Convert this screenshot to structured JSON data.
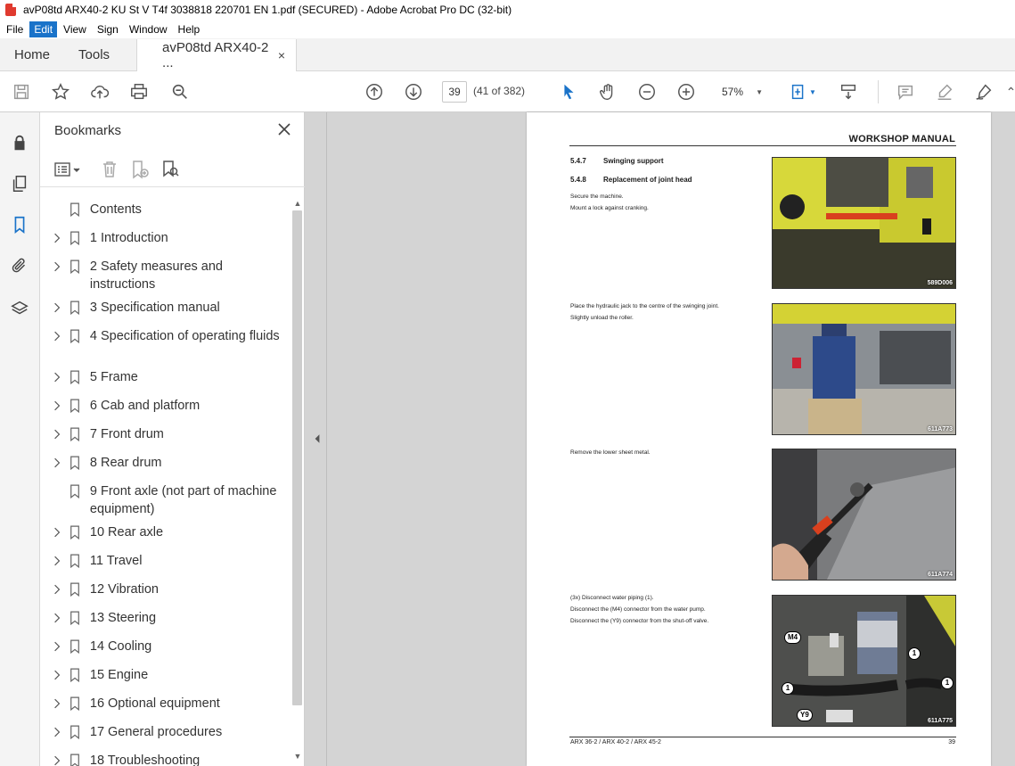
{
  "window": {
    "title": "avP08td ARX40-2 KU St V T4f 3038818 220701 EN 1.pdf (SECURED) - Adobe Acrobat Pro DC (32-bit)"
  },
  "menu": [
    "File",
    "Edit",
    "View",
    "Sign",
    "Window",
    "Help"
  ],
  "menu_active": "Edit",
  "tabs": {
    "home": "Home",
    "tools": "Tools",
    "doc": "avP08td ARX40-2 ...",
    "close": "×"
  },
  "toolbar": {
    "page_current": "39",
    "page_count": "(41 of 382)",
    "zoom": "57%"
  },
  "bookmarks": {
    "title": "Bookmarks",
    "items": [
      {
        "label": "Contents",
        "expandable": false
      },
      {
        "label": "1 Introduction",
        "expandable": true
      },
      {
        "label": "2 Safety measures and instructions",
        "expandable": true
      },
      {
        "label": "3 Specification manual",
        "expandable": true
      },
      {
        "label": "4 Specification of operating fluids",
        "expandable": true
      },
      {
        "label": "5 Frame",
        "expandable": true
      },
      {
        "label": "6 Cab and platform",
        "expandable": true
      },
      {
        "label": "7 Front drum",
        "expandable": true
      },
      {
        "label": "8 Rear drum",
        "expandable": true
      },
      {
        "label": "9 Front axle (not part of machine equipment)",
        "expandable": false
      },
      {
        "label": "10 Rear axle",
        "expandable": true
      },
      {
        "label": "11 Travel",
        "expandable": true
      },
      {
        "label": "12 Vibration",
        "expandable": true
      },
      {
        "label": "13 Steering",
        "expandable": true
      },
      {
        "label": "14 Cooling",
        "expandable": true
      },
      {
        "label": "15 Engine",
        "expandable": true
      },
      {
        "label": "16 Optional equipment",
        "expandable": true
      },
      {
        "label": "17 General procedures",
        "expandable": true
      },
      {
        "label": "18 Troubleshooting",
        "expandable": true
      }
    ]
  },
  "page": {
    "header": "WORKSHOP MANUAL",
    "sections": [
      {
        "num": "5.4.7",
        "title": "Swinging support"
      },
      {
        "num": "5.4.8",
        "title": "Replacement of joint head"
      }
    ],
    "steps": [
      {
        "lines": [
          "Secure the machine.",
          "Mount a lock against cranking."
        ],
        "caption": "589D006"
      },
      {
        "lines": [
          "Place the hydraulic jack to the centre of the swinging joint.",
          "Slightly unload the roller."
        ],
        "caption": "611A773"
      },
      {
        "lines": [
          "Remove the lower sheet metal."
        ],
        "caption": "611A774"
      },
      {
        "lines": [
          "(3x) Disconnect water piping (1).",
          "Disconnect the (M4) connector from the water pump.",
          "Disconnect the (Y9) connector from the shut-off valve."
        ],
        "caption": "611A775"
      }
    ],
    "photo4_labels": {
      "m4": "M4",
      "one": "1",
      "y9": "Y9"
    },
    "footer_left": "ARX 36-2 / ARX 40-2 / ARX 45-2",
    "footer_right": "39"
  }
}
